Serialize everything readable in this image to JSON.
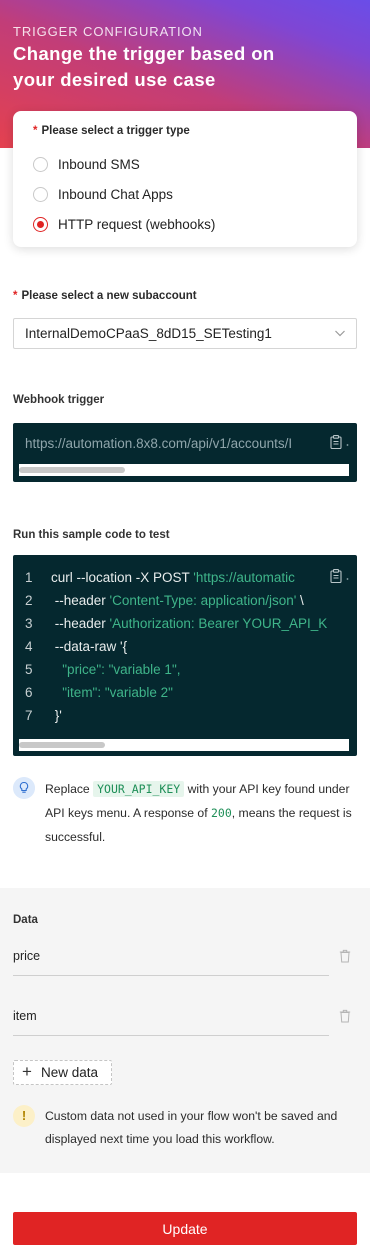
{
  "header": {
    "kicker": "TRIGGER CONFIGURATION",
    "title": "Change the trigger based on your desired use case"
  },
  "trigger_type": {
    "label": "Please select a trigger type",
    "required_mark": "*",
    "options": [
      {
        "label": "Inbound SMS",
        "selected": false
      },
      {
        "label": "Inbound Chat Apps",
        "selected": false
      },
      {
        "label": "HTTP request (webhooks)",
        "selected": true
      }
    ]
  },
  "subaccount": {
    "label": "Please select a new subaccount",
    "required_mark": "*",
    "value": "InternalDemoCPaaS_8dD15_SETesting1"
  },
  "webhook": {
    "label": "Webhook trigger",
    "url": "https://automation.8x8.com/api/v1/accounts/I",
    "scroll_position": 0.0
  },
  "sample": {
    "label": "Run this sample code to test",
    "lines": [
      {
        "num": "1",
        "text": "curl --location -X POST ",
        "str": "'https://automatic"
      },
      {
        "num": "2",
        "text": " --header ",
        "str": "'Content-Type: application/json'",
        "tail": " \\"
      },
      {
        "num": "3",
        "text": " --header ",
        "str": "'Authorization: Bearer YOUR_API_K"
      },
      {
        "num": "4",
        "text": " --data-raw '{",
        "str": ""
      },
      {
        "num": "5",
        "text": "   ",
        "str": "\"price\": \"variable 1\","
      },
      {
        "num": "6",
        "text": "   ",
        "str": "\"item\": \"variable 2\""
      },
      {
        "num": "7",
        "text": " }'",
        "str": ""
      }
    ]
  },
  "tip": {
    "before": "Replace ",
    "code": "YOUR_API_KEY",
    "middle": " with your API key found under API keys menu. A response of ",
    "number": "200",
    "after": ", means the request is successful."
  },
  "data": {
    "label": "Data",
    "fields": [
      {
        "label": "price"
      },
      {
        "label": "item"
      }
    ],
    "new_button": "New data",
    "warning_mark": "!",
    "warning": "Custom data not used in your flow won't be saved and displayed next time you load this workflow."
  },
  "update_button": "Update",
  "colors": {
    "accent": "#e02424",
    "code_bg": "#05282f",
    "code_string": "#3fb58a",
    "gradient_start": "#e4414f",
    "gradient_end": "#6a4de8"
  }
}
